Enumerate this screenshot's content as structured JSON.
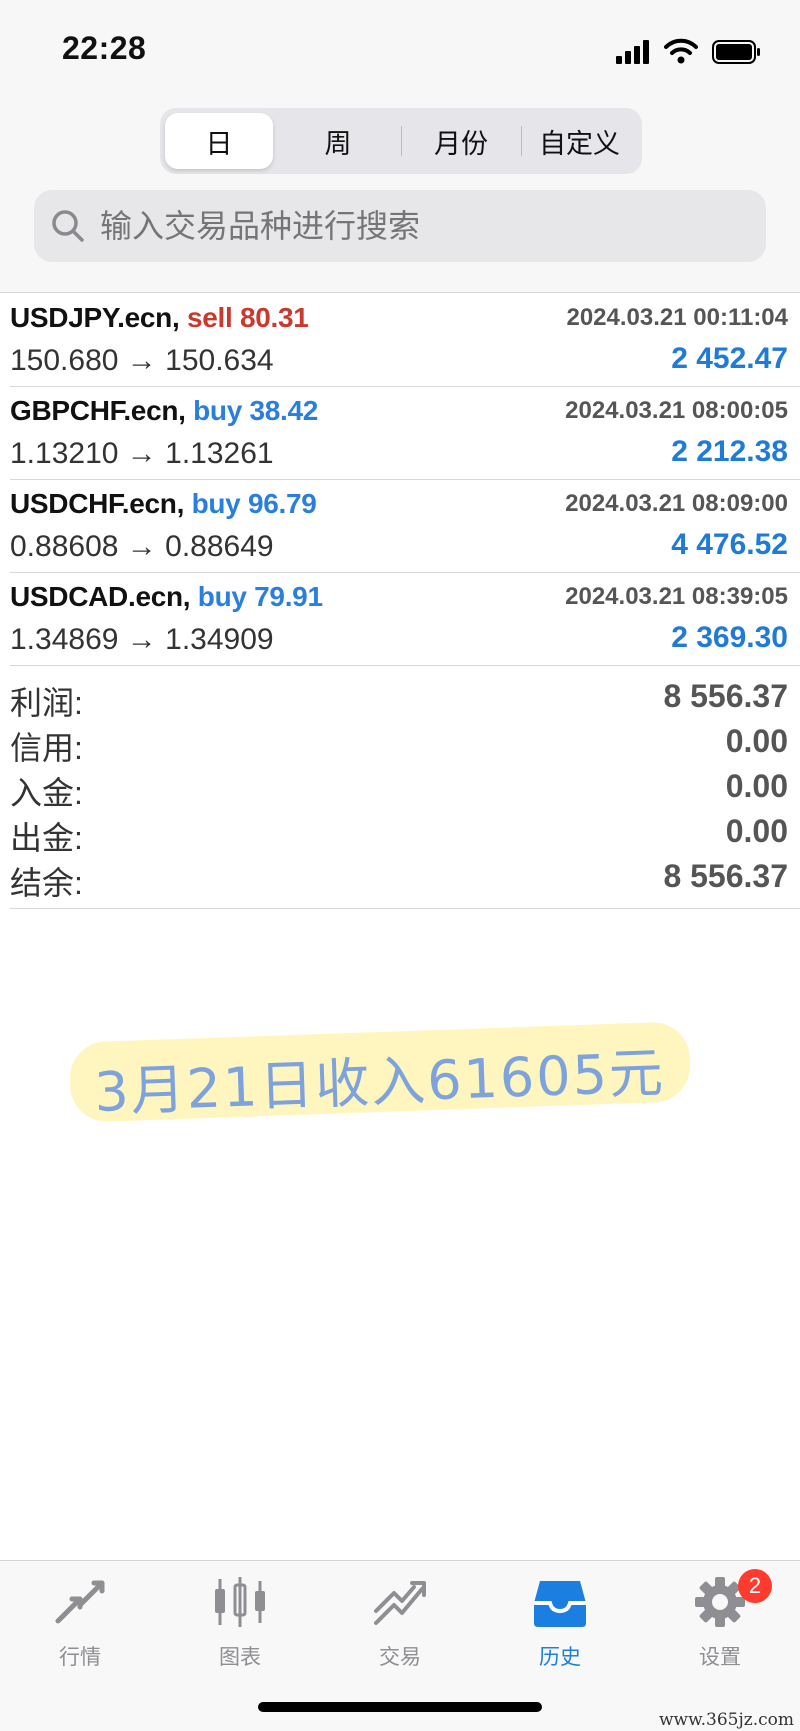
{
  "status_bar": {
    "time": "22:28"
  },
  "segments": {
    "items": [
      "日",
      "周",
      "月份",
      "自定义"
    ],
    "active_index": 0
  },
  "search": {
    "placeholder": "输入交易品种进行搜索"
  },
  "trades": [
    {
      "symbol": "USDJPY.ecn,",
      "side": "sell",
      "volume": "80.31",
      "time": "2024.03.21 00:11:04",
      "open": "150.680",
      "close": "150.634",
      "profit": "2 452.47"
    },
    {
      "symbol": "GBPCHF.ecn,",
      "side": "buy",
      "volume": "38.42",
      "time": "2024.03.21 08:00:05",
      "open": "1.13210",
      "close": "1.13261",
      "profit": "2 212.38"
    },
    {
      "symbol": "USDCHF.ecn,",
      "side": "buy",
      "volume": "96.79",
      "time": "2024.03.21 08:09:00",
      "open": "0.88608",
      "close": "0.88649",
      "profit": "4 476.52"
    },
    {
      "symbol": "USDCAD.ecn,",
      "side": "buy",
      "volume": "79.91",
      "time": "2024.03.21 08:39:05",
      "open": "1.34869",
      "close": "1.34909",
      "profit": "2 369.30"
    }
  ],
  "arrow": "→",
  "summary": {
    "profit_label": "利润:",
    "profit_value": "8 556.37",
    "credit_label": "信用:",
    "credit_value": "0.00",
    "deposit_label": "入金:",
    "deposit_value": "0.00",
    "withdrawal_label": "出金:",
    "withdrawal_value": "0.00",
    "balance_label": "结余:",
    "balance_value": "8 556.37"
  },
  "note": "3月21日收入61605元",
  "tabbar": {
    "items": [
      {
        "label": "行情",
        "icon": "quotes-icon"
      },
      {
        "label": "图表",
        "icon": "chart-candles-icon"
      },
      {
        "label": "交易",
        "icon": "trade-icon"
      },
      {
        "label": "历史",
        "icon": "history-inbox-icon"
      },
      {
        "label": "设置",
        "icon": "gear-icon"
      }
    ],
    "active_index": 3,
    "settings_badge": "2"
  },
  "watermark": "www.365jz.com",
  "colors": {
    "accent": "#1a7fe0",
    "sell": "#c9392e",
    "buy": "#2a7fdc"
  }
}
